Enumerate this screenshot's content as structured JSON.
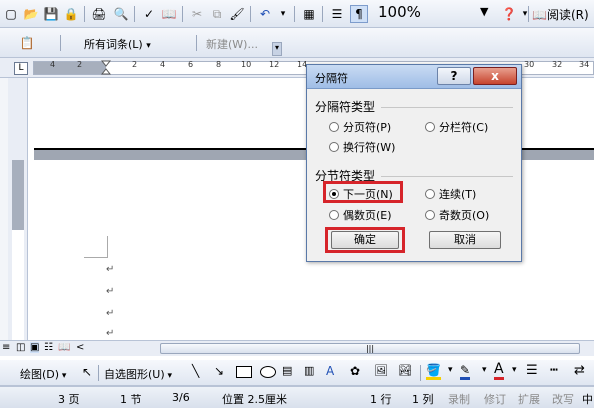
{
  "toolbar1": {
    "zoom": "100%",
    "read_label": "阅读(R)"
  },
  "toolbar2": {
    "all_entries": "所有词条(L)",
    "new_label": "新建(W)..."
  },
  "ruler": {
    "ticks": [
      "4",
      "2",
      "2",
      "4",
      "6",
      "8",
      "10",
      "12",
      "14",
      "30",
      "32",
      "34"
    ]
  },
  "dialog": {
    "title": "分隔符",
    "help_label": "?",
    "close_label": "x",
    "break_types_label": "分隔符类型",
    "page_break": "分页符(P)",
    "column_break": "分栏符(C)",
    "text_wrap_break": "换行符(W)",
    "section_types_label": "分节符类型",
    "next_page": "下一页(N)",
    "continuous": "连续(T)",
    "even_page": "偶数页(E)",
    "odd_page": "奇数页(O)",
    "ok_label": "确定",
    "cancel_label": "取消"
  },
  "drawing_bar": {
    "draw_label": "绘图(D)",
    "autoshapes_label": "自选图形(U)"
  },
  "status": {
    "page": "3 页",
    "section": "1 节",
    "page_of": "3/6",
    "position": "位置 2.5厘米",
    "line": "1 行",
    "column": "1 列",
    "rec": "录制",
    "trk": "修订",
    "ext": "扩展",
    "ovr": "改写",
    "lang": "中"
  },
  "colors": {
    "highlight_red": "#d6242a",
    "dialog_title": "#b9cfee",
    "close_button": "#c7432d"
  }
}
